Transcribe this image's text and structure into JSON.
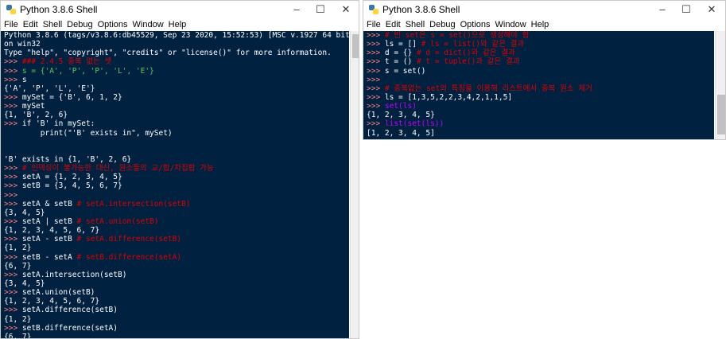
{
  "left_window": {
    "title": "Python 3.8.6 Shell",
    "menu": [
      "File",
      "Edit",
      "Shell",
      "Debug",
      "Options",
      "Window",
      "Help"
    ],
    "banner": [
      "Python 3.8.6 (tags/v3.8.6:db45529, Sep 23 2020, 15:52:53) [MSC v.1927 64 bit (AMD64)]",
      "on win32",
      "Type \"help\", \"copyright\", \"credits\" or \"license()\" for more information."
    ],
    "lines": [
      {
        "prompt": ">>> ",
        "text": "### 2.4.5 중복 없는 셋",
        "cls": "c"
      },
      {
        "prompt": ">>> ",
        "text": "s = {'A', 'P', 'P', 'L', 'E'}",
        "cls": "s"
      },
      {
        "prompt": ">>> ",
        "text": "s",
        "cls": "o"
      },
      {
        "prompt": "",
        "text": "{'A', 'P', 'L', 'E'}",
        "cls": "o"
      },
      {
        "prompt": ">>> ",
        "text": "mySet = {'B', 6, 1, 2}",
        "cls": "o"
      },
      {
        "prompt": ">>> ",
        "text": "mySet",
        "cls": "o"
      },
      {
        "prompt": "",
        "text": "{1, 'B', 2, 6}",
        "cls": "o"
      },
      {
        "prompt": ">>> ",
        "text": "if 'B' in mySet:",
        "cls": "o"
      },
      {
        "prompt": "",
        "text": "\tprint(\"'B' exists in\", mySet)",
        "cls": "o"
      },
      {
        "prompt": "",
        "text": "",
        "cls": "o"
      },
      {
        "prompt": "",
        "text": "",
        "cls": "o"
      },
      {
        "prompt": "",
        "text": "'B' exists in {1, 'B', 2, 6}",
        "cls": "o"
      },
      {
        "prompt": ">>> ",
        "text": "# 인덱싱이 불가능한 대신, 원소들의 교/합/차집합 가능",
        "cls": "c"
      },
      {
        "prompt": ">>> ",
        "text": "setA = {1, 2, 3, 4, 5}",
        "cls": "o"
      },
      {
        "prompt": ">>> ",
        "text": "setB = {3, 4, 5, 6, 7}",
        "cls": "o"
      },
      {
        "prompt": ">>> ",
        "text": "",
        "cls": "o"
      },
      {
        "prompt": ">>> ",
        "text": "setA & setB ",
        "cls": "o",
        "comment": "# setA.intersection(setB)"
      },
      {
        "prompt": "",
        "text": "{3, 4, 5}",
        "cls": "o"
      },
      {
        "prompt": ">>> ",
        "text": "setA | setB ",
        "cls": "o",
        "comment": "# setA.union(setB)"
      },
      {
        "prompt": "",
        "text": "{1, 2, 3, 4, 5, 6, 7}",
        "cls": "o"
      },
      {
        "prompt": ">>> ",
        "text": "setA - setB ",
        "cls": "o",
        "comment": "# setA.difference(setB)"
      },
      {
        "prompt": "",
        "text": "{1, 2}",
        "cls": "o"
      },
      {
        "prompt": ">>> ",
        "text": "setB - setA ",
        "cls": "o",
        "comment": "# setB.difference(setA)"
      },
      {
        "prompt": "",
        "text": "{6, 7}",
        "cls": "o"
      },
      {
        "prompt": ">>> ",
        "text": "setA.intersection(setB)",
        "cls": "o"
      },
      {
        "prompt": "",
        "text": "{3, 4, 5}",
        "cls": "o"
      },
      {
        "prompt": ">>> ",
        "text": "setA.union(setB)",
        "cls": "o"
      },
      {
        "prompt": "",
        "text": "{1, 2, 3, 4, 5, 6, 7}",
        "cls": "o"
      },
      {
        "prompt": ">>> ",
        "text": "setA.difference(setB)",
        "cls": "o"
      },
      {
        "prompt": "",
        "text": "{1, 2}",
        "cls": "o"
      },
      {
        "prompt": ">>> ",
        "text": "setB.difference(setA)",
        "cls": "o"
      },
      {
        "prompt": "",
        "text": "{6, 7}",
        "cls": "o"
      }
    ]
  },
  "right_window": {
    "title": "Python 3.8.6 Shell",
    "menu": [
      "File",
      "Edit",
      "Shell",
      "Debug",
      "Options",
      "Window",
      "Help"
    ],
    "lines": [
      {
        "prompt": ">>> ",
        "text": "# 빈 set은 s = set()으로 생성해야 함",
        "cls": "c"
      },
      {
        "prompt": ">>> ",
        "text": "ls = [] ",
        "cls": "o",
        "comment": "# ls = list()와 같은 결과"
      },
      {
        "prompt": ">>> ",
        "text": "d = {} ",
        "cls": "o",
        "comment": "# d = dict()와 같은 결과"
      },
      {
        "prompt": ">>> ",
        "text": "t = () ",
        "cls": "o",
        "comment": "# t = tuple()과 같은 결과"
      },
      {
        "prompt": ">>> ",
        "text": "s = set()",
        "cls": "o"
      },
      {
        "prompt": ">>> ",
        "text": "",
        "cls": "o"
      },
      {
        "prompt": ">>> ",
        "text": "# 중복없는 set의 특징을 이용해 리스트에서 중복 원소 제거",
        "cls": "c"
      },
      {
        "prompt": ">>> ",
        "text": "ls = [1,3,5,2,2,3,4,2,1,1,5]",
        "cls": "o"
      },
      {
        "prompt": ">>> ",
        "text": "set(ls)",
        "cls": "b"
      },
      {
        "prompt": "",
        "text": "{1, 2, 3, 4, 5}",
        "cls": "o"
      },
      {
        "prompt": ">>> ",
        "text": "list(set(ls))",
        "cls": "b"
      },
      {
        "prompt": "",
        "text": "[1, 2, 3, 4, 5]",
        "cls": "o"
      }
    ]
  },
  "controls": {
    "minimize": "–",
    "maximize": "☐",
    "close": "✕"
  },
  "colors": {
    "console_bg": "#002240",
    "prompt": "#ff7f7f",
    "comment": "#dd0000",
    "builtin": "#c000ff"
  }
}
